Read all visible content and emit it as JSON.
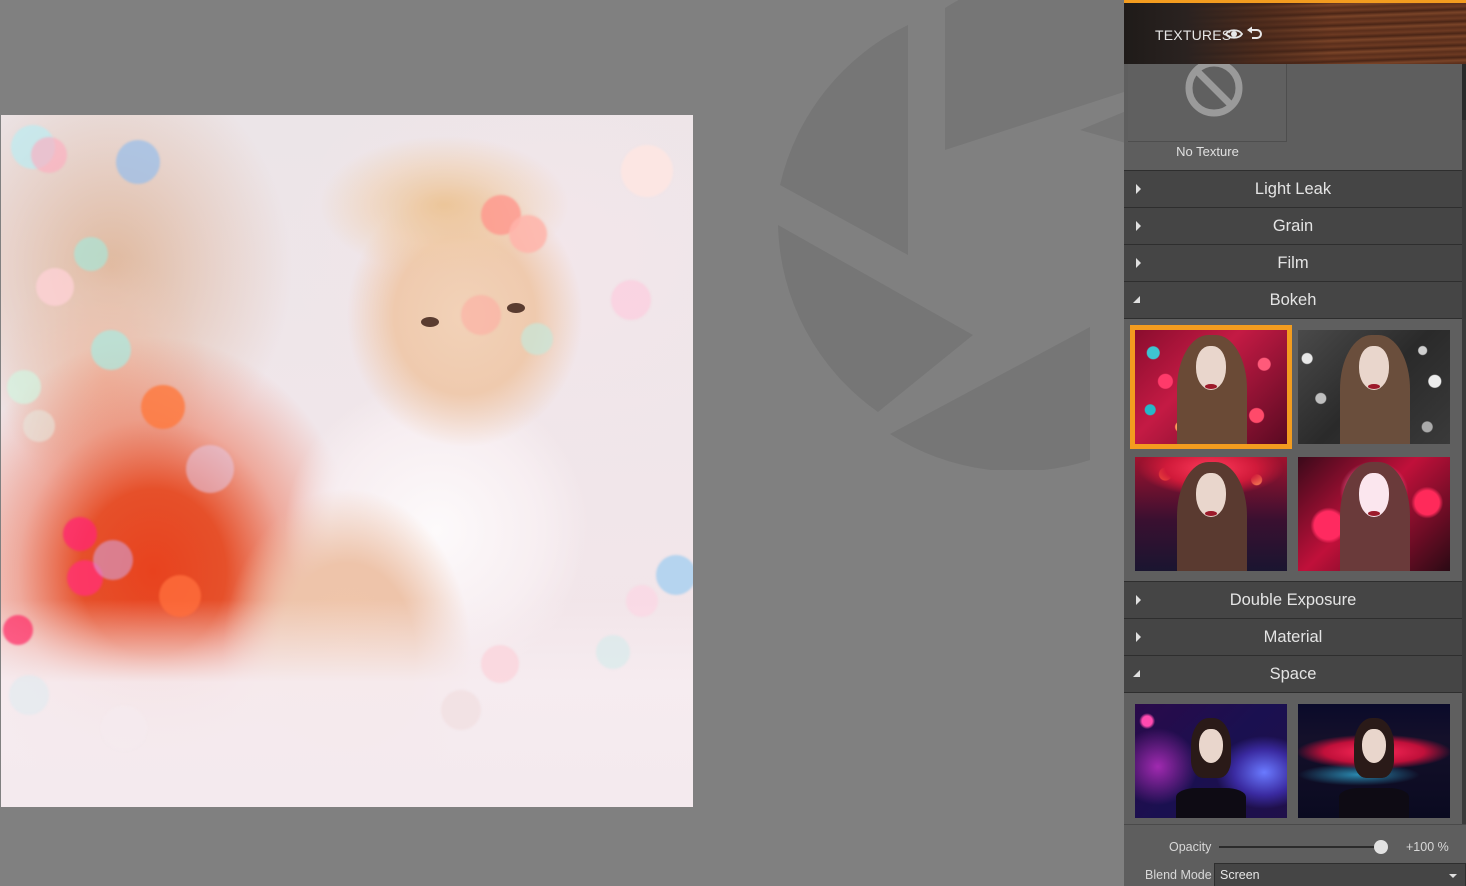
{
  "colors": {
    "accent": "#f39c1f",
    "panel_bg": "#5e5e5e",
    "category_bg": "#454545",
    "workspace_bg": "#808080"
  },
  "canvas": {
    "image_description": "Baby sitting on a bed with mother in orange shirt in background, bokeh overlay applied",
    "watermark_icon": "aperture-logo-icon"
  },
  "panel": {
    "title": "TEXTURES",
    "header_icons": [
      "eye-icon",
      "undo-icon"
    ],
    "no_texture": {
      "icon": "prohibited-icon",
      "label": "No Texture"
    },
    "categories": [
      {
        "label": "Light Leak",
        "expanded": false
      },
      {
        "label": "Grain",
        "expanded": false
      },
      {
        "label": "Film",
        "expanded": false
      },
      {
        "label": "Bokeh",
        "expanded": true,
        "thumbnails": [
          {
            "name": "bokeh-1",
            "description": "woman with colorful red and teal bokeh",
            "selected": true
          },
          {
            "name": "bokeh-2",
            "description": "woman with gray/white bokeh",
            "selected": false
          },
          {
            "name": "bokeh-3",
            "description": "woman with red overhead bokeh",
            "selected": false
          },
          {
            "name": "bokeh-4",
            "description": "woman with bright pink bokeh glow",
            "selected": false
          }
        ]
      },
      {
        "label": "Double Exposure",
        "expanded": false
      },
      {
        "label": "Material",
        "expanded": false
      },
      {
        "label": "Space",
        "expanded": true,
        "thumbnails": [
          {
            "name": "space-1",
            "description": "woman with purple/blue galaxy",
            "selected": false
          },
          {
            "name": "space-2",
            "description": "woman with red and blue nebula",
            "selected": false
          }
        ]
      }
    ],
    "opacity": {
      "label": "Opacity",
      "value_text": "+100 %",
      "value_fraction": 1.0
    },
    "blend_mode": {
      "label": "Blend Mode",
      "value": "Screen"
    }
  }
}
